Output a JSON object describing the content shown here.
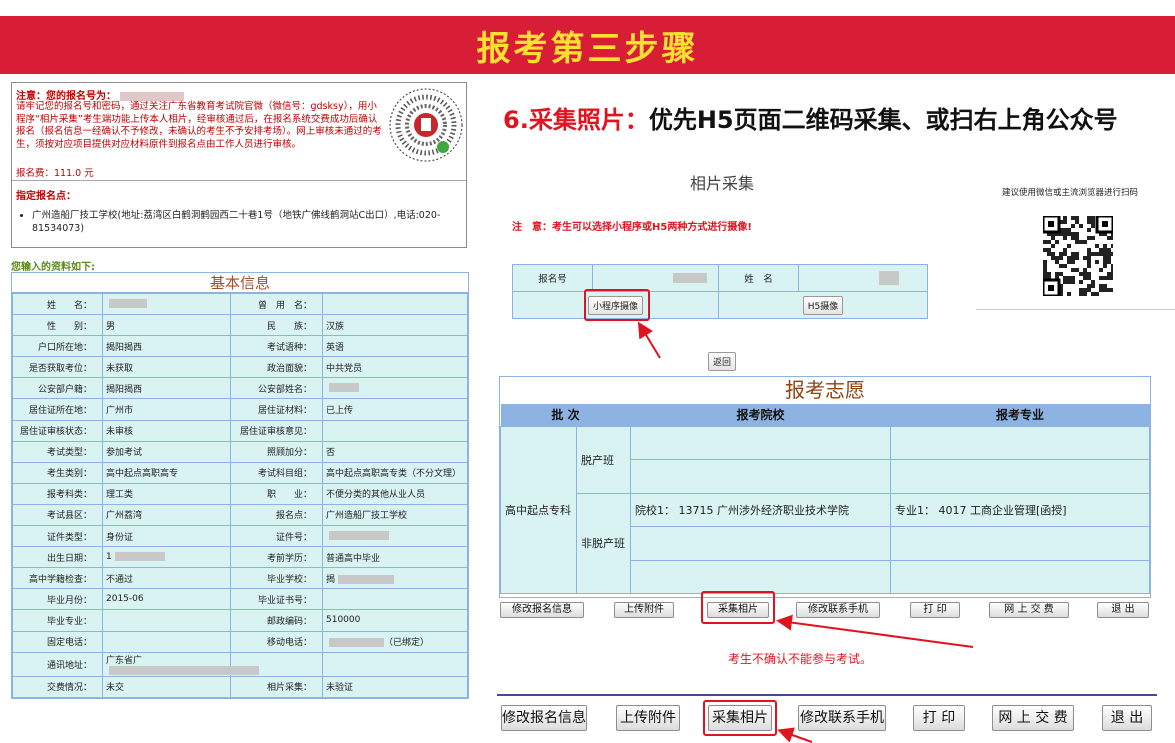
{
  "banner": {
    "title": "报考第三步骤"
  },
  "notice": {
    "reg_label": "注意：您的报名号为：",
    "text": "请牢记您的报名号和密码，通过关注广东省教育考试院官微（微信号：gdsksy），用小程序“相片采集”考生端功能上传本人相片，经审核通过后，在报名系统交费成功后确认报名（报名信息一经确认不予修改，未确认的考生不予安排考场）。网上审核未通过的考生，须按对应项目提供对应材料原件到报名点由工作人员进行审核。",
    "fee_label": "报名费：",
    "fee_value": "111.0 元",
    "site_heading": "指定报名点：",
    "site_item": "广州造船厂技工学校(地址:荔湾区白鹤洞鹤园西二十巷1号（地铁广佛线鹤洞站C出口）,电话:020-81534073)"
  },
  "input_label": "您输入的资料如下:",
  "basic": {
    "title": "基本信息",
    "rows": [
      [
        "姓　　名：",
        "",
        "曾　用　名：",
        ""
      ],
      [
        "性　　别：",
        "男",
        "民　　族：",
        "汉族"
      ],
      [
        "户口所在地：",
        "揭阳揭西",
        "考试语种：",
        "英语"
      ],
      [
        "是否获取考位：",
        "未获取",
        "政治面貌：",
        "中共党员"
      ],
      [
        "公安部户籍：",
        "揭阳揭西",
        "公安部姓名：",
        ""
      ],
      [
        "居住证所在地：",
        "广州市",
        "居住证材料：",
        "已上传"
      ],
      [
        "居住证审核状态：",
        "未审核",
        "居住证审核意见：",
        ""
      ],
      [
        "考试类型：",
        "参加考试",
        "照顾加分：",
        "否"
      ],
      [
        "考生类别：",
        "高中起点高职高专",
        "考试科目组：",
        "高中起点高职高专类（不分文理）"
      ],
      [
        "报考科类：",
        "理工类",
        "职　　业：",
        "不便分类的其他从业人员"
      ],
      [
        "考试县区：",
        "广州荔湾",
        "报名点：",
        "广州造船厂技工学校"
      ],
      [
        "证件类型：",
        "身份证",
        "证件号：",
        ""
      ],
      [
        "出生日期：",
        "1",
        "考前学历：",
        "普通高中毕业"
      ],
      [
        "高中学籍检查：",
        "不通过",
        "毕业学校：",
        "揭"
      ],
      [
        "毕业月份：",
        "2015-06",
        "毕业证书号：",
        ""
      ],
      [
        "毕业专业：",
        "",
        "邮政编码：",
        "510000"
      ],
      [
        "固定电话：",
        "",
        "移动电话：",
        "（已绑定）"
      ],
      [
        "通讯地址：",
        "广东省广",
        "",
        ""
      ],
      [
        "交费情况：",
        "未交",
        "相片采集：",
        "未验证"
      ]
    ]
  },
  "step": {
    "num": "6.采集照片：",
    "text": "优先H5页面二维码采集、或扫右上角公众号"
  },
  "photo": {
    "title": "相片采集",
    "attention": "注　意：考生可以选择小程序或H5两种方式进行摄像!",
    "reg_no_label": "报名号",
    "name_label": "姓　名",
    "mini_btn": "小程序摄像",
    "h5_btn": "H5摄像",
    "back_btn": "返回",
    "rec_text": "建议使用微信或主流浏览器进行扫码"
  },
  "wish": {
    "title": "报考志愿",
    "headers": [
      "批 次",
      "报考院校",
      "报考专业"
    ],
    "batch": "高中起点专科",
    "type1": "脱产班",
    "type2": "非脱产班",
    "school": "院校1：  13715  广州涉外经济职业技术学院",
    "major": "专业1：  4017 工商企业管理[函授]"
  },
  "buttons": {
    "modify_info": "修改报名信息",
    "upload": "上传附件",
    "photo": "采集相片",
    "modify_phone": "修改联系手机",
    "print": "打 印",
    "pay": "网 上 交 费",
    "exit": "退 出"
  },
  "warning": "考生不确认不能参与考试。",
  "colors": {
    "banner": "#d81e36",
    "banner_text": "#ffe032",
    "accent_red": "#e0141e",
    "table_bg": "#d9f2f2",
    "table_border": "#8db3e2"
  }
}
